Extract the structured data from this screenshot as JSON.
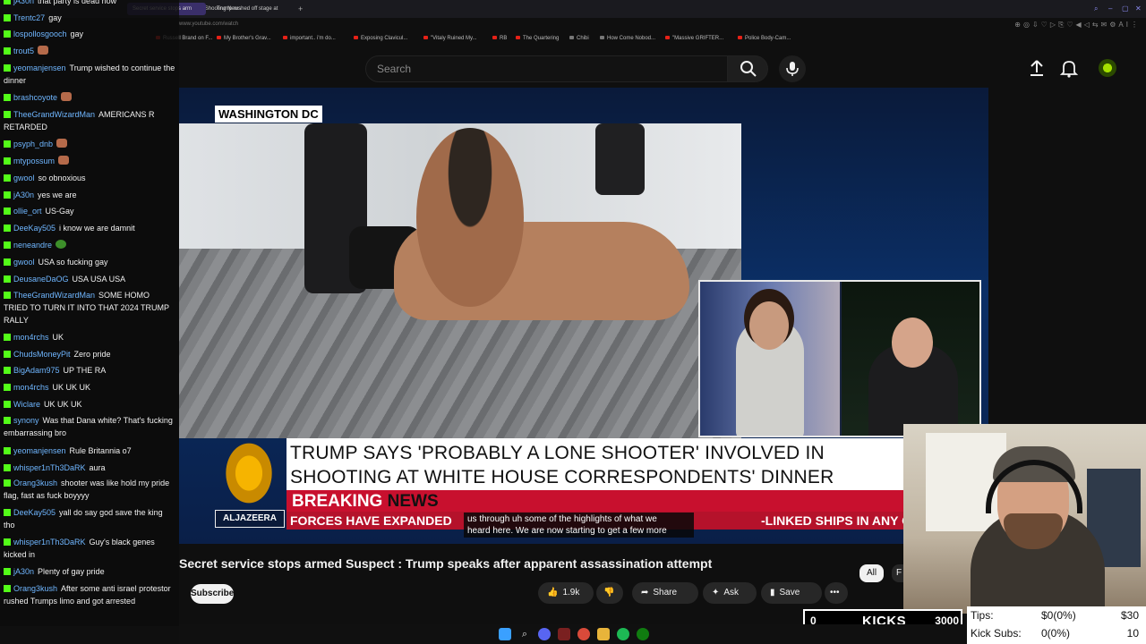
{
  "browser": {
    "tabs": [
      {
        "label": "Trump Shooting News",
        "active": false
      },
      {
        "label": "Secret service stops arm",
        "active": true
      },
      {
        "label": "Trump rushed off stage at",
        "active": false
      }
    ],
    "url": "www.youtube.com/watch",
    "bookmarks": [
      "Russell Brand on F...",
      "My Brother's Grav...",
      "important.. i'm do...",
      "Exposing Clavicul...",
      "\"Vitaly Ruined My...",
      "RB",
      "The Quartering",
      "Chibi",
      "How Come Nobod...",
      "\"Massive GRIFTER...",
      "Police Body-Cam..."
    ]
  },
  "youtube": {
    "search_placeholder": "Search",
    "title": "Secret service stops armed Suspect : Trump speaks after apparent assassination attempt",
    "subscribe_label": "Subscribe",
    "likes": "1.9k",
    "share_label": "Share",
    "ask_label": "Ask",
    "save_label": "Save",
    "chips": [
      "All",
      "F"
    ]
  },
  "broadcast": {
    "dateline": "WASHINGTON DC",
    "headline_line1": "TRUMP SAYS 'PROBABLY A LONE SHOOTER' INVOLVED IN",
    "headline_line2": "SHOOTING AT WHITE HOUSE CORRESPONDENTS' DINNER",
    "breaking": "BREAKING",
    "news": "NEWS",
    "ticker_left": "FORCES HAVE EXPANDED",
    "ticker_right": "-LINKED SHIPS IN ANY OCEAN",
    "logo_text": "ALJAZEERA",
    "caption_line1": "us through uh some of the highlights of what we",
    "caption_line2": "heard here. We are now starting to get a few more"
  },
  "chat": [
    {
      "user": "jA30n",
      "text": "that party is dead now"
    },
    {
      "user": "Trentc27",
      "text": "gay"
    },
    {
      "user": "lospollosgooch",
      "text": "gay"
    },
    {
      "user": "trout5",
      "text": "",
      "emote": "face"
    },
    {
      "user": "yeomanjensen",
      "text": "Trump wished to continue the dinner"
    },
    {
      "user": "brashcoyote",
      "text": "",
      "emote": "face"
    },
    {
      "user": "TheeGrandWizardMan",
      "text": "AMERICANS R RETARDED"
    },
    {
      "user": "psyph_dnb",
      "text": "",
      "emote": "face"
    },
    {
      "user": "mtypossum",
      "text": "",
      "emote": "face"
    },
    {
      "user": "gwool",
      "text": "so obnoxious"
    },
    {
      "user": "jA30n",
      "text": "yes we are"
    },
    {
      "user": "ollie_ort",
      "text": "US-Gay"
    },
    {
      "user": "DeeKay505",
      "text": "i know we are damnit"
    },
    {
      "user": "neneandre",
      "text": "",
      "emote": "green"
    },
    {
      "user": "gwool",
      "text": "USA so fucking gay"
    },
    {
      "user": "DeusaneDaOG",
      "text": "USA USA USA"
    },
    {
      "user": "TheeGrandWizardMan",
      "text": "SOME HOMO TRIED TO TURN IT INTO THAT 2024 TRUMP RALLY"
    },
    {
      "user": "mon4rchs",
      "text": "UK"
    },
    {
      "user": "ChudsMoneyPit",
      "text": "Zero pride"
    },
    {
      "user": "BigAdam975",
      "text": "UP THE RA"
    },
    {
      "user": "mon4rchs",
      "text": "UK UK UK"
    },
    {
      "user": "Wiclare",
      "text": "UK UK UK"
    },
    {
      "user": "synony",
      "text": "Was that Dana white? That's fucking embarrassing bro"
    },
    {
      "user": "yeomanjensen",
      "text": "Rule Britannia o7"
    },
    {
      "user": "whisper1nTh3DaRK",
      "text": "aura"
    },
    {
      "user": "Orang3kush",
      "text": "shooter was like hold my pride flag, fast as fuck boyyyy"
    },
    {
      "user": "DeeKay505",
      "text": "yall do say god save the king tho"
    },
    {
      "user": "whisper1nTh3DaRK",
      "text": "Guy's black genes kicked in"
    },
    {
      "user": "jA30n",
      "text": "Plenty of gay pride"
    },
    {
      "user": "Orang3kush",
      "text": "After some anti israel protestor rushed Trumps limo and got arrested"
    }
  ],
  "kicks": {
    "count": "0",
    "label": "KICKS",
    "goal": "3000"
  },
  "tips": {
    "tips_label": "Tips:",
    "tips_value": "$0(0%)",
    "tips_goal": "$30",
    "subs_label": "Kick Subs:",
    "subs_value": "0(0%)",
    "subs_goal": "10"
  },
  "colors": {
    "kick_green": "#53fc18",
    "chat_user": "#6fb6ff",
    "aj_red": "#c8102e",
    "aj_gold": "#f6b400"
  }
}
